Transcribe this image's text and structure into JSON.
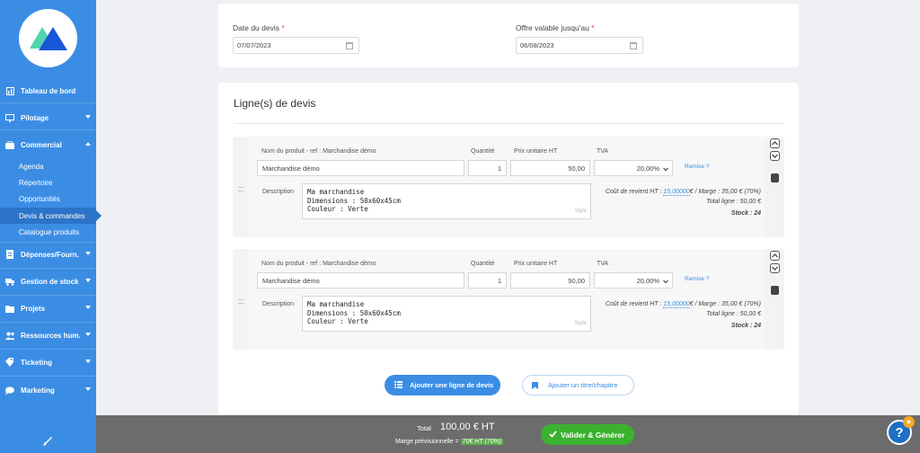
{
  "sidebar": {
    "items": [
      {
        "label": "Tableau de bord",
        "icon": "dashboard-icon"
      },
      {
        "label": "Pilotage",
        "icon": "monitor-icon"
      },
      {
        "label": "Commercial",
        "icon": "briefcase-icon"
      },
      {
        "label": "Dépenses/Fourn.",
        "icon": "receipt-icon"
      },
      {
        "label": "Gestion de stock",
        "icon": "truck-icon"
      },
      {
        "label": "Projets",
        "icon": "folder-icon"
      },
      {
        "label": "Ressources hum.",
        "icon": "users-icon"
      },
      {
        "label": "Ticketing",
        "icon": "ticket-icon"
      },
      {
        "label": "Marketing",
        "icon": "chat-icon"
      }
    ],
    "commercial_sub": [
      "Agenda",
      "Répertoire",
      "Opportunités",
      "Devis & commandes",
      "Catalogue produits"
    ],
    "active_sub": "Devis & commandes"
  },
  "dates": {
    "date_label": "Date du devis",
    "date_value": "07/07/2023",
    "valid_label": "Offre valable jusqu'au",
    "valid_value": "06/08/2023",
    "required_mark": "*"
  },
  "lines": {
    "title": "Ligne(s) de devis",
    "headers": {
      "product": "Nom du produit - ref : Marchandise démo",
      "qty": "Quantité",
      "price": "Prix unitaire HT",
      "vat": "TVA"
    },
    "remise_label": "Remise ?",
    "description_label": "Description",
    "style_label": "Style",
    "rows": [
      {
        "product": "Marchandise démo",
        "qty": "1",
        "price": "50,00",
        "vat": "20,00%",
        "desc1": "Ma marchandise",
        "desc2": "Dimensions : 50x60x45cm",
        "desc3": "Couleur : Verte",
        "cost_prefix": "Coût de revient HT :",
        "cost_value": "15,00000",
        "cost_suffix": "€ / Marge : 35,00 € (70%)",
        "total_line": "Total ligne : 50,00 €",
        "stock": "Stock : 24"
      },
      {
        "product": "Marchandise démo",
        "qty": "1",
        "price": "50,00",
        "vat": "20,00%",
        "desc1": "Ma marchandise",
        "desc2": "Dimensions : 50x60x45cm",
        "desc3": "Couleur : Verte",
        "cost_prefix": "Coût de revient HT :",
        "cost_value": "15,00000",
        "cost_suffix": "€ / Marge : 35,00 € (70%)",
        "total_line": "Total ligne : 50,00 €",
        "stock": "Stock : 24"
      }
    ],
    "add_line_button": "Ajouter une ligne de devis",
    "add_title_button": "Ajouter un titre/chapitre"
  },
  "footer": {
    "total_label": "Total",
    "total_value": "100,00 € HT",
    "margin_label": "Marge prévisionnelle =",
    "margin_value": "70€ HT (70%)",
    "validate_button": "Valider & Générer",
    "help_label": "?",
    "badge": "★"
  },
  "colors": {
    "sidebar": "#3b8de4",
    "active": "#2c74c8",
    "green": "#3bb22f",
    "footer": "#6c6c6c"
  }
}
